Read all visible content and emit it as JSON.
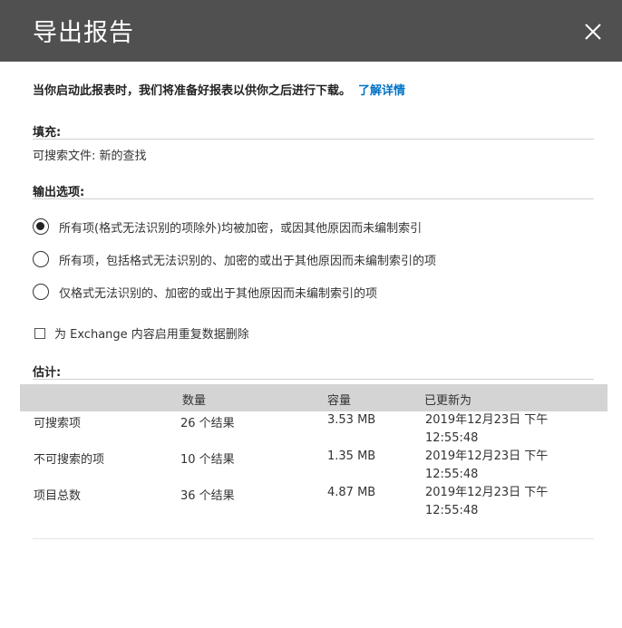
{
  "dialog": {
    "title": "导出报告",
    "intro_text": "当你启动此报表时，我们将准备好报表以供你之后进行下载。",
    "learn_more": "了解详情"
  },
  "fill": {
    "heading": "填充:",
    "value": "可搜索文件: 新的查找"
  },
  "output_options": {
    "heading": "输出选项:",
    "options": [
      {
        "label": "所有项(格式无法识别的项除外)均被加密，或因其他原因而未编制索引",
        "selected": true
      },
      {
        "label": "所有项，包括格式无法识别的、加密的或出于其他原因而未编制索引的项",
        "selected": false
      },
      {
        "label": "仅格式无法识别的、加密的或出于其他原因而未编制索引的项",
        "selected": false
      }
    ]
  },
  "dedupe": {
    "label": "为 Exchange 内容启用重复数据删除",
    "checked": false
  },
  "estimate": {
    "heading": "估计:",
    "columns": [
      "数量",
      "容量",
      "已更新为"
    ],
    "rows": [
      {
        "name": "可搜索项",
        "count": "26 个结果",
        "size": "3.53 MB",
        "updated_line1": "2019年12月23日 下午",
        "updated_line2": "12:55:48"
      },
      {
        "name": "不可搜索的项",
        "count": "10 个结果",
        "size": "1.35 MB",
        "updated_line1": "2019年12月23日 下午",
        "updated_line2": "12:55:48"
      },
      {
        "name": "项目总数",
        "count": "36 个结果",
        "size": "4.87 MB",
        "updated_line1": "2019年12月23日 下午",
        "updated_line2": "12:55:48"
      }
    ]
  },
  "icons": {
    "close": "close-icon"
  }
}
